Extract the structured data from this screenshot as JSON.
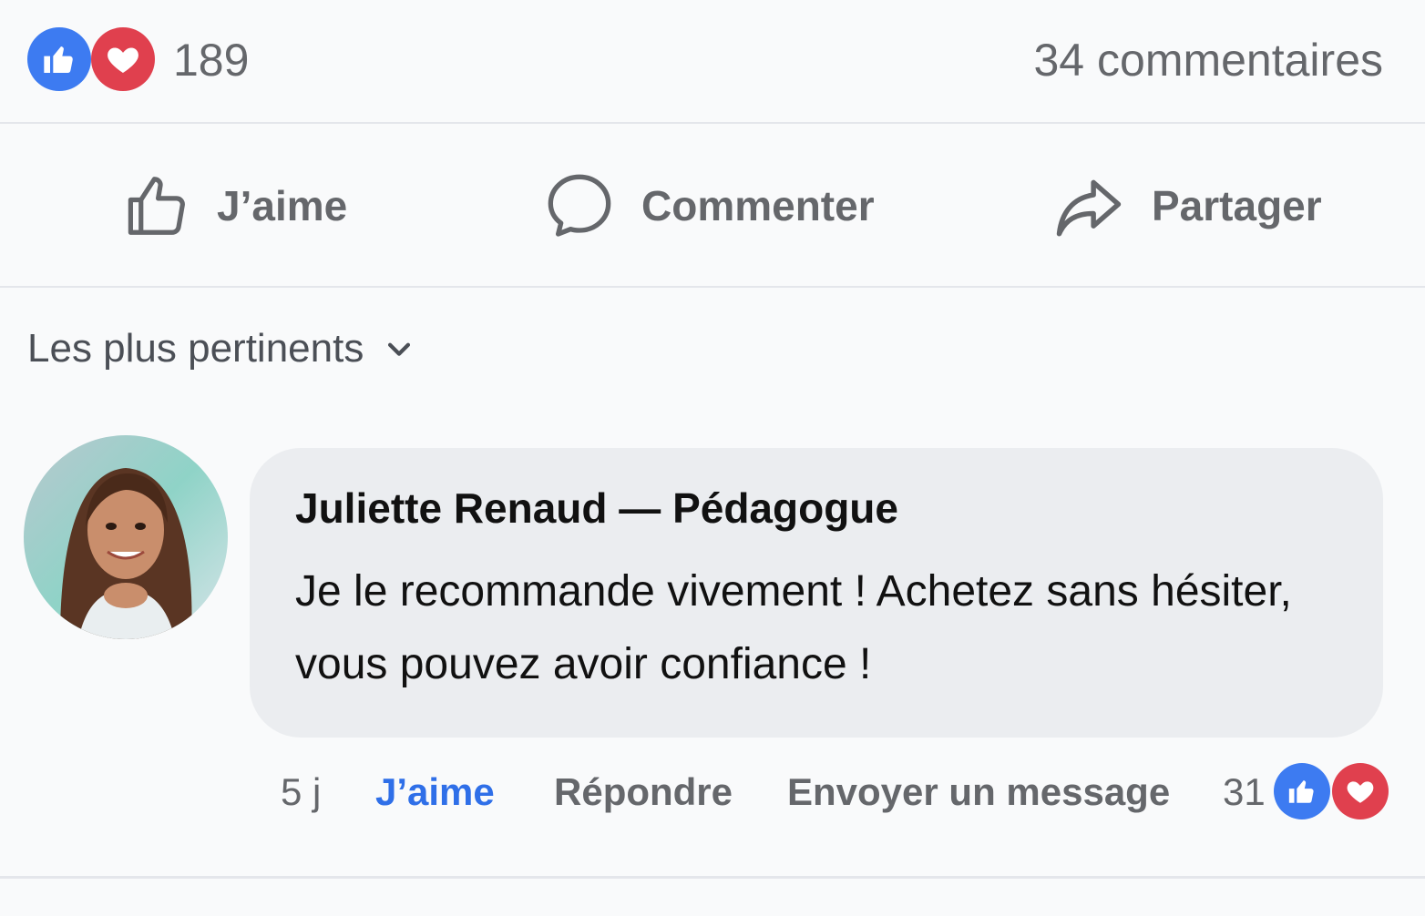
{
  "reactions": {
    "count": "189",
    "comments_count": "34 commentaires",
    "icons": [
      "thumbs-up-icon",
      "heart-icon"
    ],
    "like_color": "#3d7bf1",
    "love_color": "#e0404e"
  },
  "actions": {
    "like_label": "J’aime",
    "comment_label": "Commenter",
    "share_label": "Partager"
  },
  "sort": {
    "label": "Les plus pertinents",
    "icon": "chevron-down-icon"
  },
  "comment": {
    "author": "Juliette Renaud — Pédagogue",
    "text": "Je le recommande vivement ! Achetez sans hésiter, vous pouvez avoir confiance !",
    "time": "5 j",
    "like_label": "J’aime",
    "reply_label": "Répondre",
    "message_label": "Envoyer un message",
    "reaction_count": "31",
    "like_active_color": "#2f6fe8"
  },
  "colors": {
    "background": "#f9fafb",
    "bubble": "#ebedf0",
    "muted_text": "#65676b",
    "divider": "#e4e6eb"
  }
}
